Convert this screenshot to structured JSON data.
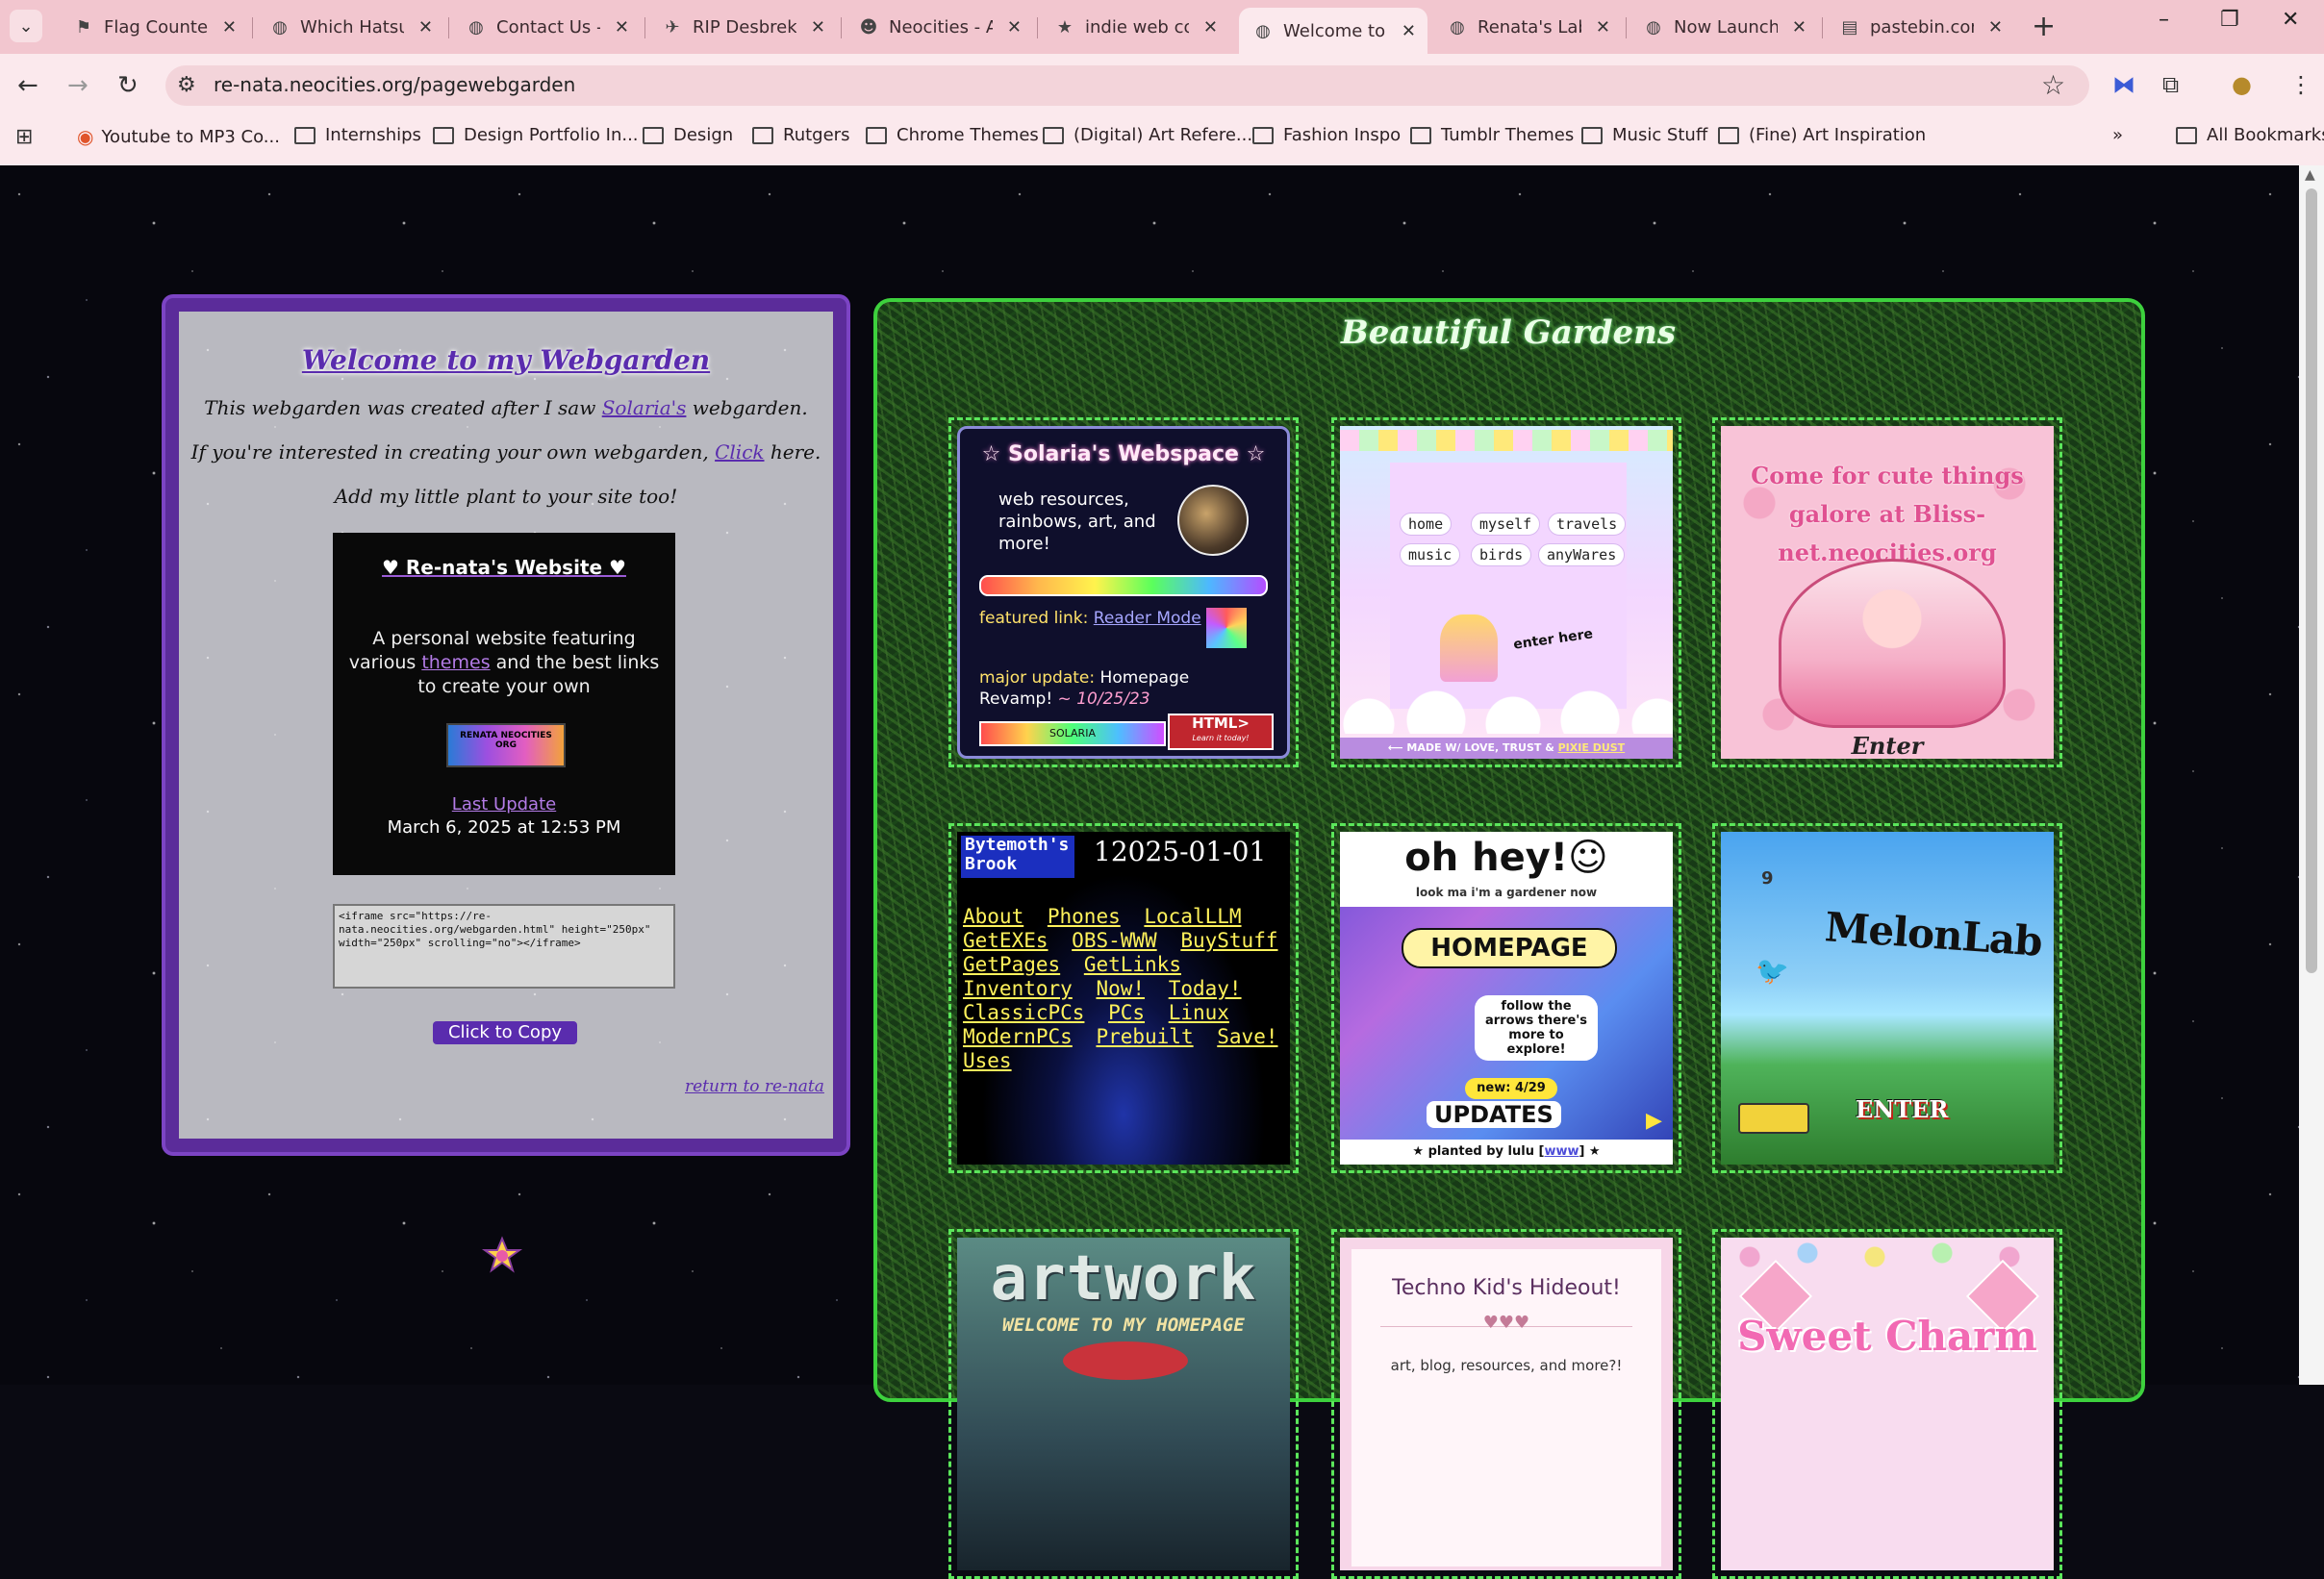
{
  "browser": {
    "tabs": [
      {
        "title": "Flag Counter",
        "icon": "flag-counter-icon"
      },
      {
        "title": "Which Hatsun",
        "icon": "globe-icon"
      },
      {
        "title": "Contact Us - t",
        "icon": "globe-icon"
      },
      {
        "title": "RIP Desbreko",
        "icon": "bird-icon"
      },
      {
        "title": "Neocities - Ac",
        "icon": "cat-icon"
      },
      {
        "title": "indie web con",
        "icon": "star-icon"
      },
      {
        "title": "Welcome to n",
        "icon": "globe-icon",
        "active": true
      },
      {
        "title": "Renata's Labo",
        "icon": "globe-icon"
      },
      {
        "title": "Now Launchir",
        "icon": "globe-icon"
      },
      {
        "title": "pastebin.com",
        "icon": "clipboard-icon"
      }
    ],
    "url": "re-nata.neocities.org/pagewebgarden",
    "bookmarks": [
      {
        "label": "Youtube to MP3 Co...",
        "icon": "app-icon"
      },
      {
        "label": "Internships",
        "icon": "folder-icon"
      },
      {
        "label": "Design Portfolio In...",
        "icon": "folder-icon"
      },
      {
        "label": "Design",
        "icon": "folder-icon"
      },
      {
        "label": "Rutgers",
        "icon": "folder-icon"
      },
      {
        "label": "Chrome Themes",
        "icon": "folder-icon"
      },
      {
        "label": "(Digital) Art Refere...",
        "icon": "folder-icon"
      },
      {
        "label": "Fashion Inspo",
        "icon": "folder-icon"
      },
      {
        "label": "Tumblr Themes",
        "icon": "folder-icon"
      },
      {
        "label": "Music Stuff",
        "icon": "folder-icon"
      },
      {
        "label": "(Fine) Art Inspiration",
        "icon": "folder-icon"
      }
    ],
    "all_bookmarks": "All Bookmarks",
    "more": "»"
  },
  "left": {
    "title": "Welcome to my Webgarden",
    "line1_a": "This webgarden was created after I saw ",
    "line1_link": "Solaria's",
    "line1_b": " webgarden.",
    "line2_a": "If you're interested in creating your own webgarden, ",
    "line2_link": "Click",
    "line2_b": " here.",
    "line3": "Add my little plant to your site too!",
    "site": {
      "title": "♥ Re-nata's Website ♥",
      "desc_a": "A personal website featuring various ",
      "desc_link": "themes",
      "desc_b": " and the best links to create your own",
      "badge": "RENATA NEOCITIES ORG",
      "last_update_label": "Last Update",
      "last_update": "March 6, 2025 at 12:53 PM"
    },
    "code": "<iframe src=\"https://re-nata.neocities.org/webgarden.html\" height=\"250px\" width=\"250px\" scrolling=\"no\"></iframe>",
    "copy_button": "Click to Copy",
    "return_link": "return to re-nata"
  },
  "right": {
    "title": "Beautiful Gardens",
    "solaria": {
      "title": "☆ Solaria's Webspace ☆",
      "desc": "web resources, rainbows, art, and more!",
      "featured_label": "featured link: ",
      "featured_link": "Reader Mode",
      "major_label": "major update: ",
      "major_text": "Homepage Revamp!",
      "major_date": " ~ 10/25/23",
      "badge_left": "SOLARIA",
      "badge_right": "HTML>",
      "badge_right_sub": "Learn it today!"
    },
    "pixie": {
      "nav": [
        "home",
        "myself",
        "travels",
        "music",
        "birds",
        "anyWares"
      ],
      "label": "enter here",
      "footer_a": "⟵ MADE W/ LOVE, TRUST & ",
      "footer_link": "PIXIE DUST"
    },
    "bliss": {
      "text": "Come for cute things galore at Bliss-net.neocities.org",
      "enter": "Enter"
    },
    "brook": {
      "logo": "Bytemoth's Brook",
      "date": "12025-01-01",
      "links": [
        "About",
        "Phones",
        "LocalLLM",
        "GetEXEs",
        "OBS-WWW",
        "BuyStuff",
        "GetPages",
        "GetLinks",
        "Inventory",
        "Now!",
        "Today!",
        "ClassicPCs",
        "PCs",
        "Linux",
        "ModernPCs",
        "Prebuilt",
        "Save!",
        "Uses"
      ]
    },
    "lulu": {
      "hey": "oh hey!☺",
      "sub": "look ma i'm a gardener now",
      "home": "HOMEPAGE",
      "arrows": "follow the arrows there's more to explore!",
      "new": "new: 4/29",
      "updates": "UPDATES",
      "footer_a": "★ planted by lulu [",
      "footer_link": "www",
      "footer_b": "] ★"
    },
    "melon": {
      "num": "9",
      "title": "MelonLab",
      "enter": "ENTER"
    },
    "artwork": {
      "title": "artwork",
      "sub": "WELCOME TO MY HOMEPAGE"
    },
    "techno": {
      "title": "Techno Kid's Hideout!",
      "hearts": "♥♥♥",
      "desc": "art, blog, resources, and more?!"
    },
    "charm": {
      "title": "Sweet Charm"
    }
  }
}
